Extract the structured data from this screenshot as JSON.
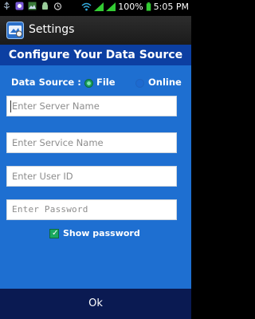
{
  "status_bar": {
    "battery": "100%",
    "time": "5:05 PM"
  },
  "action_bar": {
    "title": "Settings"
  },
  "form": {
    "heading": "Configure Your Data Source",
    "data_source_label": "Data Source :",
    "options": [
      "File",
      "Online"
    ],
    "selected_option": "File",
    "fields": {
      "server_placeholder": "Enter Server Name",
      "service_placeholder": "Enter Service Name",
      "user_placeholder": "Enter User ID",
      "password_placeholder": "Enter Password"
    },
    "show_password_label": "Show password",
    "show_password_checked": true
  },
  "bottom": {
    "ok_label": "Ok"
  },
  "colors": {
    "form_background": "#1e6fd1",
    "header_background": "#0c3fa2",
    "bottom_bar": "#0a1a52",
    "radio_selected": "#1a9b5b"
  }
}
